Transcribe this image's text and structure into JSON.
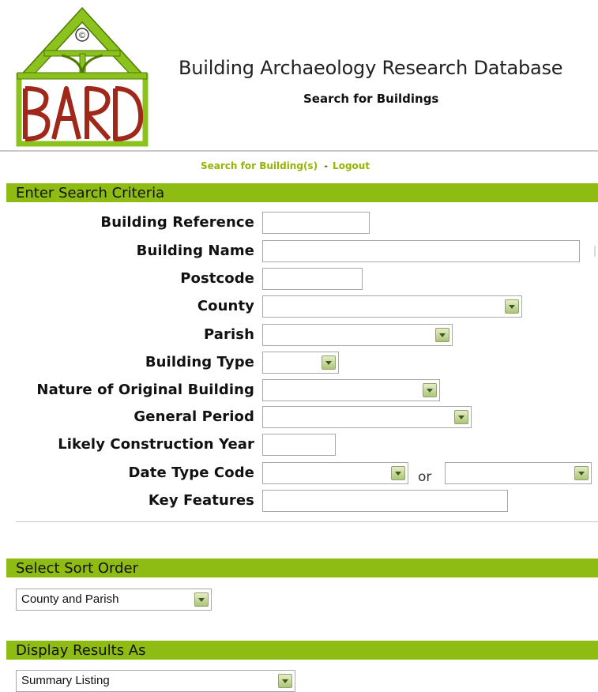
{
  "header": {
    "title": "Building Archaeology Research Database",
    "subtitle": "Search for Buildings",
    "logo_text": "BARD",
    "logo_copyright": "©"
  },
  "nav": {
    "search_link": "Search for Building(s)",
    "separator": "-",
    "logout_link": "Logout"
  },
  "search_criteria": {
    "heading": "Enter Search Criteria",
    "fields": {
      "building_reference": {
        "label": "Building Reference",
        "value": ""
      },
      "building_name": {
        "label": "Building Name",
        "value": ""
      },
      "postcode": {
        "label": "Postcode",
        "value": ""
      },
      "county": {
        "label": "County",
        "value": ""
      },
      "parish": {
        "label": "Parish",
        "value": ""
      },
      "building_type": {
        "label": "Building Type",
        "value": ""
      },
      "nature_of_original_building": {
        "label": "Nature of Original Building",
        "value": ""
      },
      "general_period": {
        "label": "General Period",
        "value": ""
      },
      "likely_construction_year": {
        "label": "Likely Construction Year",
        "value": ""
      },
      "date_type_code": {
        "label": "Date Type Code",
        "value_1": "",
        "or_label": "or",
        "value_2": ""
      },
      "key_features": {
        "label": "Key Features",
        "value": ""
      }
    }
  },
  "sort_order": {
    "heading": "Select Sort Order",
    "selected": "County and Parish"
  },
  "display_results": {
    "heading": "Display Results As",
    "selected": "Summary Listing"
  },
  "colors": {
    "accent_green": "#8fbc12",
    "link_green": "#96b400",
    "logo_red": "#a0281a",
    "logo_green": "#8cc21e"
  }
}
